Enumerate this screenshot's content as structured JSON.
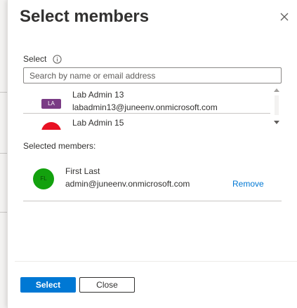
{
  "dialog": {
    "title": "Select members",
    "close_icon": "close-icon"
  },
  "select_section": {
    "label": "Select",
    "info_icon": "info-icon",
    "search_placeholder": "Search by name or email address",
    "search_value": ""
  },
  "results": [
    {
      "avatar_initials": "LA",
      "avatar_color": "#7a3b85",
      "name": "Lab Admin 13",
      "email": "labadmin13@juneenv.onmicrosoft.com"
    },
    {
      "avatar_initials": "",
      "avatar_color": "#e81123",
      "name": "Lab Admin 15"
    }
  ],
  "selected_section": {
    "label": "Selected members:",
    "members": [
      {
        "avatar_initials": "FL",
        "avatar_color": "#13a10e",
        "name": "First Last",
        "email": "admin@juneenv.onmicrosoft.com",
        "remove_label": "Remove"
      }
    ]
  },
  "footer": {
    "select_label": "Select",
    "close_label": "Close"
  },
  "colors": {
    "primary": "#0078d4",
    "link": "#0078d4"
  }
}
